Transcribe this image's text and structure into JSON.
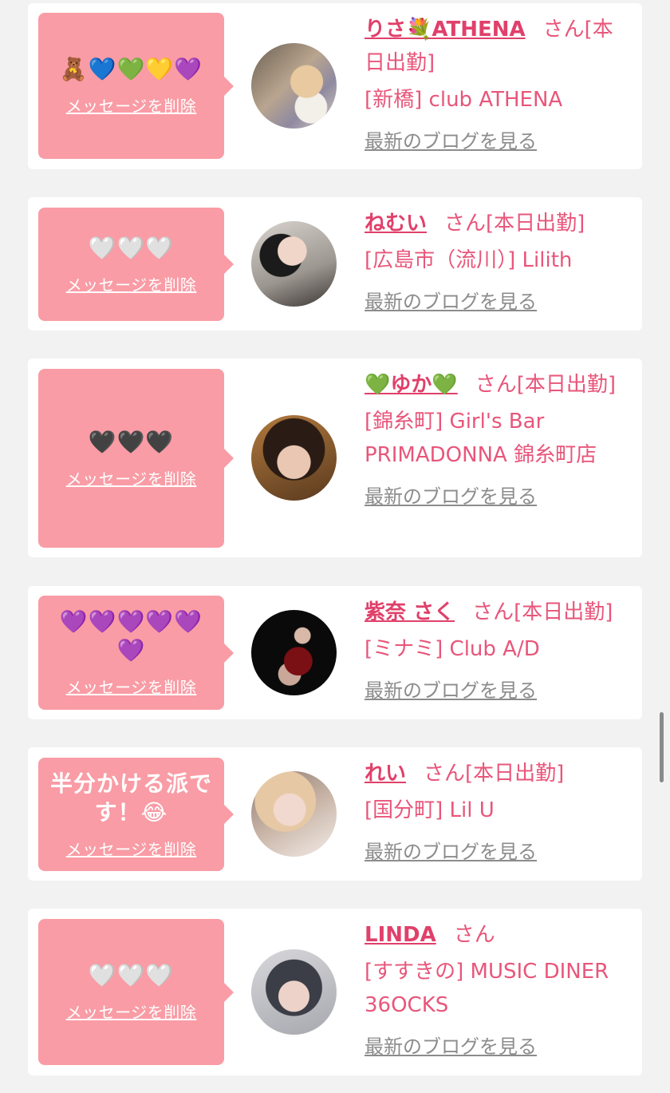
{
  "entries": [
    {
      "message": "🧸💙💚💛💜",
      "delete_label": "メッセージを削除",
      "name": "りさ💐ATHENA",
      "status": "さん[本日出勤]",
      "shop": "[新橋] club ATHENA",
      "blog_label": "最新のブログを見る"
    },
    {
      "message": "🤍🤍🤍",
      "delete_label": "メッセージを削除",
      "name": "ねむい",
      "status": "さん[本日出勤]",
      "shop": "[広島市（流川）] Lilith",
      "blog_label": "最新のブログを見る"
    },
    {
      "message": "🖤🖤🖤",
      "delete_label": "メッセージを削除",
      "name": "💚ゆか💚",
      "status": "さん[本日出勤]",
      "shop": "[錦糸町] Girl's Bar PRIMADONNA 錦糸町店",
      "blog_label": "最新のブログを見る"
    },
    {
      "message": "💜💜💜💜💜💜",
      "delete_label": "メッセージを削除",
      "name": "紫奈 さく",
      "status": "さん[本日出勤]",
      "shop": "[ミナミ] Club A/D",
      "blog_label": "最新のブログを見る"
    },
    {
      "message": "半分かける派です！😂",
      "delete_label": "メッセージを削除",
      "name": "れい",
      "status": "さん[本日出勤]",
      "shop": "[国分町] Lil U",
      "blog_label": "最新のブログを見る"
    },
    {
      "message": "🤍🤍🤍",
      "delete_label": "メッセージを削除",
      "name": "LINDA",
      "status": "さん",
      "shop": "[すすきの] MUSIC DINER 36OCKS",
      "blog_label": "最新のブログを見る"
    }
  ],
  "colors": {
    "background": "#f2f2f2",
    "bubble": "#f99ca5",
    "name": "#e0406a",
    "text_pink": "#e8567a",
    "link_gray": "#8c8c8c"
  }
}
